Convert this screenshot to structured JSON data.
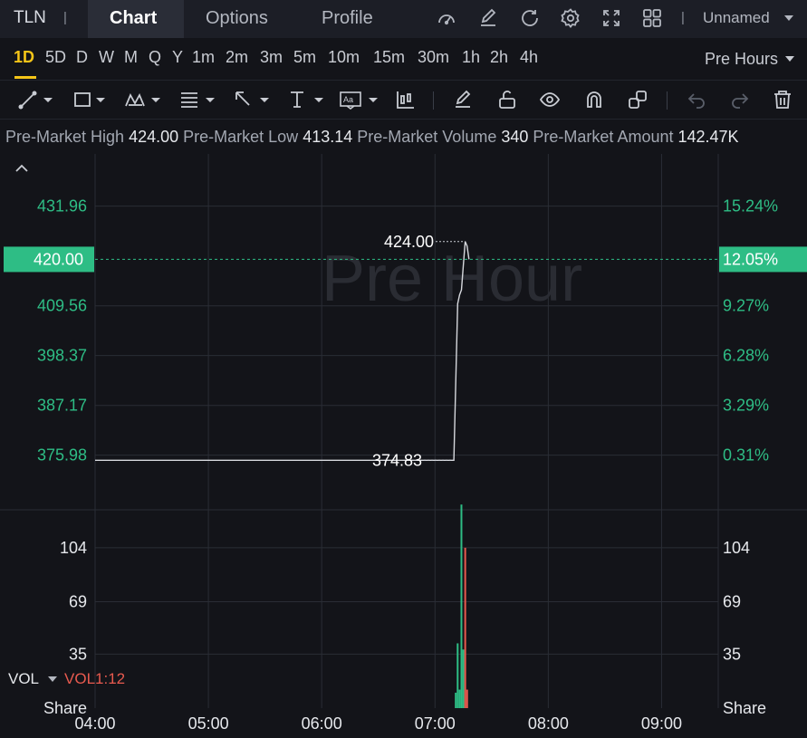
{
  "header": {
    "ticker": "TLN",
    "separator": "|",
    "tabs": {
      "chart": "Chart",
      "options": "Options",
      "profile": "Profile"
    },
    "layout_separator": "|",
    "layout_name": "Unnamed"
  },
  "timeframes": {
    "items": [
      "1D",
      "5D",
      "D",
      "W",
      "M",
      "Q",
      "Y",
      "1m",
      "2m",
      "3m",
      "5m",
      "10m",
      "15m",
      "30m",
      "1h",
      "2h",
      "4h"
    ],
    "active": "1D",
    "session": "Pre Hours"
  },
  "info": {
    "high_label": "Pre-Market High",
    "high_value": "424.00",
    "low_label": "Pre-Market Low",
    "low_value": "413.14",
    "volume_label": "Pre-Market Volume",
    "volume_value": "340",
    "amount_label": "Pre-Market Amount",
    "amount_value": "142.47K"
  },
  "volume_panel": {
    "label": "VOL",
    "indicator": "VOL1:12"
  },
  "colors": {
    "up": "#2ebd85",
    "down": "#e85a4f",
    "active": "#f5c518",
    "price_tag": "#2ebd85"
  },
  "chart_data": {
    "type": "line",
    "watermark": "Pre Hour",
    "x_ticks": [
      "04:00",
      "05:00",
      "06:00",
      "07:00",
      "08:00",
      "09:00"
    ],
    "price_ticks": [
      "431.96",
      "409.56",
      "398.37",
      "387.17",
      "375.98"
    ],
    "pct_ticks": [
      "15.24%",
      "9.27%",
      "6.28%",
      "3.29%",
      "0.31%"
    ],
    "current_price": "420.00",
    "current_pct": "12.05%",
    "high_label": "424.00",
    "low_label": "374.83",
    "ylim": [
      363.9,
      443.7
    ],
    "series": [
      {
        "x": [
          "04:00",
          "07:10",
          "07:12",
          "07:13",
          "07:14",
          "07:15",
          "07:16",
          "07:17",
          "07:18"
        ],
        "values": [
          374.83,
          374.83,
          410.0,
          412.0,
          413.14,
          418.5,
          424.0,
          423.0,
          420.0
        ]
      }
    ],
    "volume": {
      "ticks": [
        "104",
        "69",
        "35"
      ],
      "unit": "Share",
      "ylim": [
        0,
        128
      ],
      "bars": [
        {
          "x": "07:11",
          "value": 10,
          "dir": "up"
        },
        {
          "x": "07:12",
          "value": 42,
          "dir": "up"
        },
        {
          "x": "07:13",
          "value": 12,
          "dir": "up"
        },
        {
          "x": "07:14",
          "value": 132,
          "dir": "up"
        },
        {
          "x": "07:15",
          "value": 38,
          "dir": "up"
        },
        {
          "x": "07:16",
          "value": 104,
          "dir": "down"
        },
        {
          "x": "07:17",
          "value": 12,
          "dir": "down"
        }
      ]
    }
  }
}
